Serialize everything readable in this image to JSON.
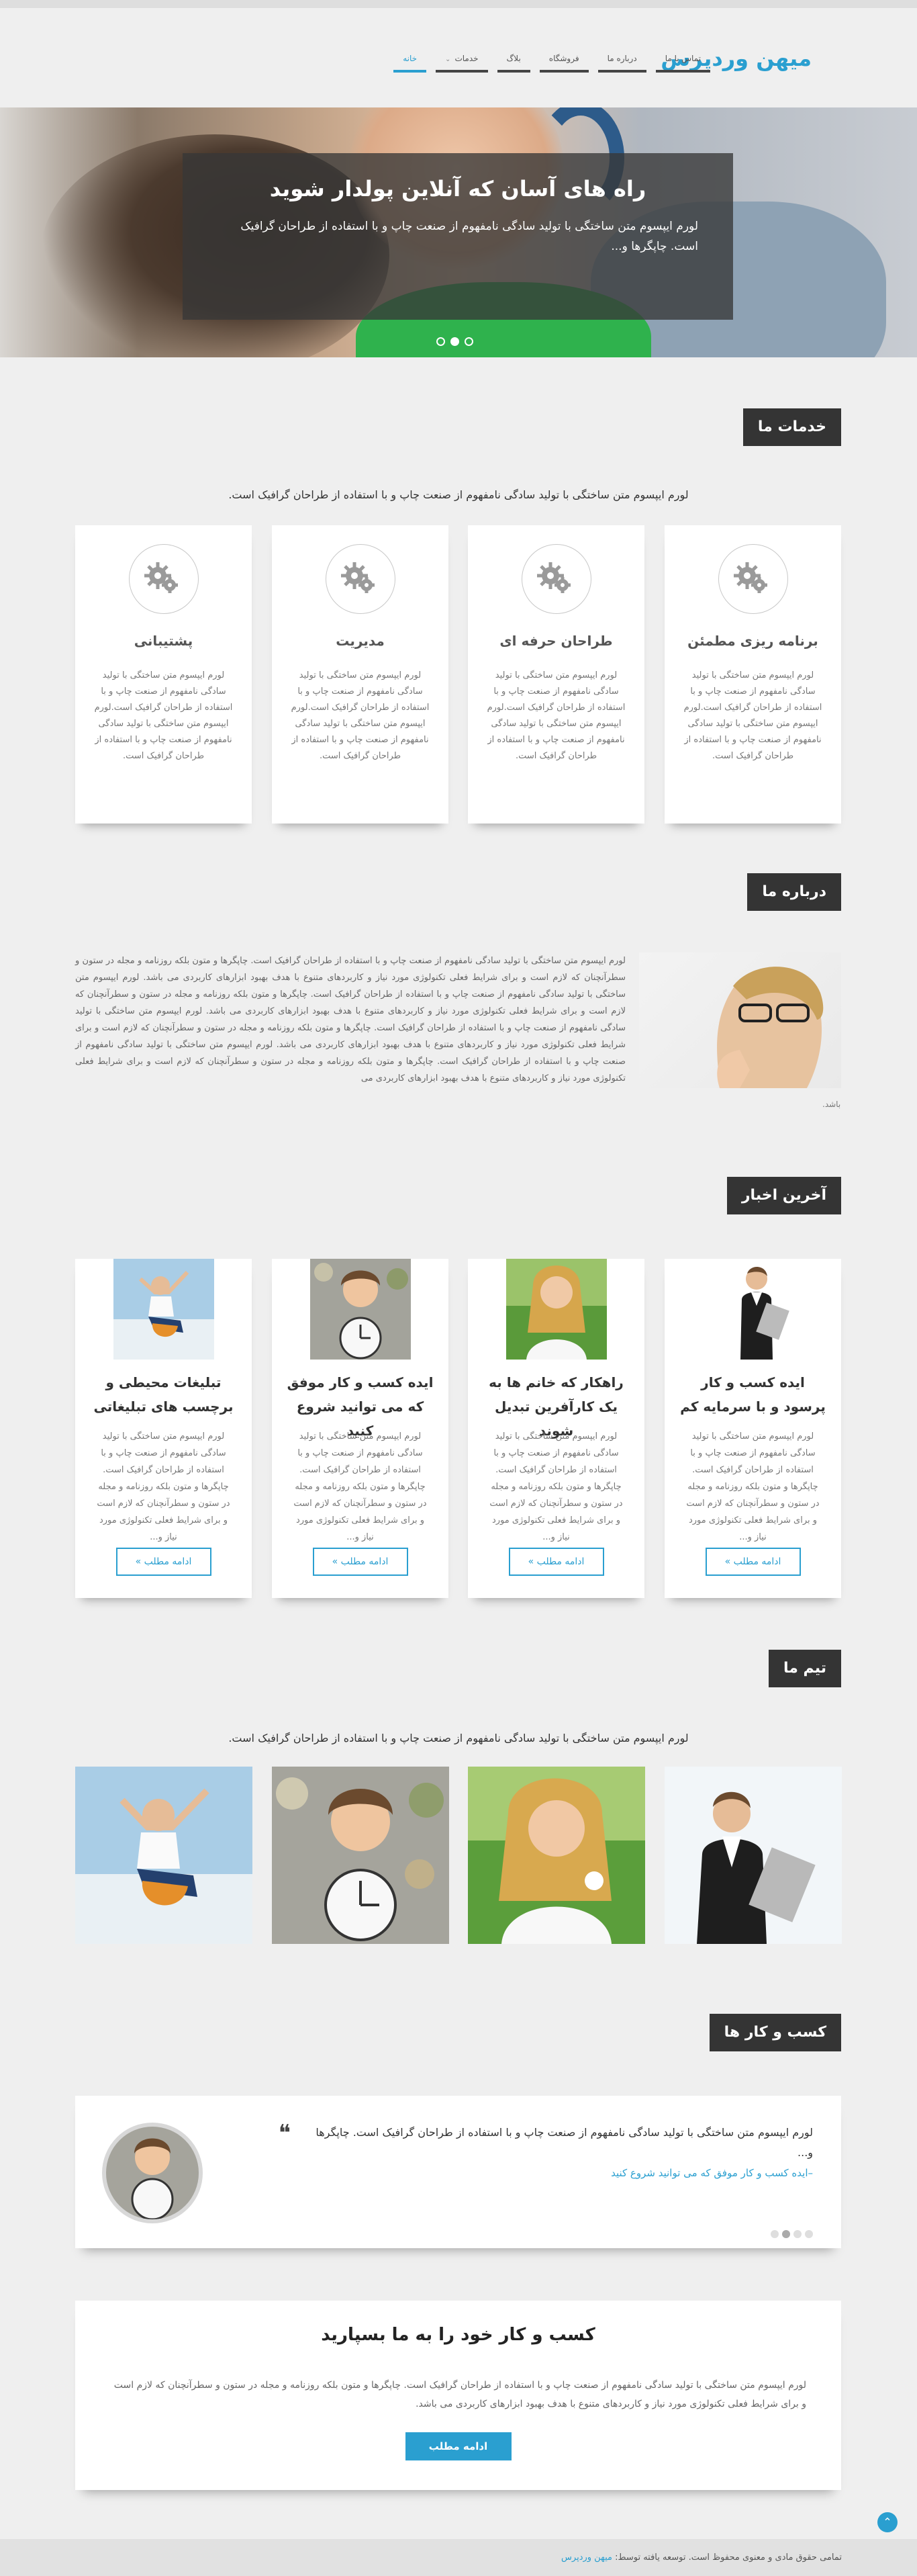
{
  "header": {
    "logo": "میهن وردپرس",
    "nav": [
      {
        "label": "خانه",
        "active": true
      },
      {
        "label": "خدمات",
        "has_dropdown": true
      },
      {
        "label": "بلاگ"
      },
      {
        "label": "فروشگاه"
      },
      {
        "label": "درباره ما"
      },
      {
        "label": "تماس با ما"
      }
    ]
  },
  "hero": {
    "title": "راه های آسان که آنلاین پولدار شوید",
    "text": "لورم ایپسوم متن ساختگی با تولید سادگی نامفهوم از صنعت چاپ و با استفاده از طراحان گرافیک است. چاپگرها و...",
    "slides": 3,
    "active_slide": 2
  },
  "services": {
    "title": "خدمات ما",
    "intro": "لورم ایپسوم متن ساختگی با تولید سادگی نامفهوم از صنعت چاپ و با استفاده از طراحان گرافیک است.",
    "icon": "gears-icon",
    "items": [
      {
        "title": "برنامه ریزی مطمئن",
        "text": "لورم ایپسوم متن ساختگی با تولید سادگی نامفهوم از صنعت چاپ و با استفاده از طراحان گرافیک است.لورم ایپسوم متن ساختگی با تولید سادگی نامفهوم از صنعت چاپ و با استفاده از طراحان گرافیک است."
      },
      {
        "title": "طراحان حرفه ای",
        "text": "لورم ایپسوم متن ساختگی با تولید سادگی نامفهوم از صنعت چاپ و با استفاده از طراحان گرافیک است.لورم ایپسوم متن ساختگی با تولید سادگی نامفهوم از صنعت چاپ و با استفاده از طراحان گرافیک است."
      },
      {
        "title": "مدیریت",
        "text": "لورم ایپسوم متن ساختگی با تولید سادگی نامفهوم از صنعت چاپ و با استفاده از طراحان گرافیک است.لورم ایپسوم متن ساختگی با تولید سادگی نامفهوم از صنعت چاپ و با استفاده از طراحان گرافیک است."
      },
      {
        "title": "پشتیبانی",
        "text": "لورم ایپسوم متن ساختگی با تولید سادگی نامفهوم از صنعت چاپ و با استفاده از طراحان گرافیک است.لورم ایپسوم متن ساختگی با تولید سادگی نامفهوم از صنعت چاپ و با استفاده از طراحان گرافیک است."
      }
    ]
  },
  "about": {
    "title": "درباره ما",
    "text": "لورم ایپسوم متن ساختگی با تولید سادگی نامفهوم از صنعت چاپ و با استفاده از طراحان گرافیک است. چاپگرها و متون بلکه روزنامه و مجله در ستون و سطرآنچنان که لازم است و برای شرایط فعلی تکنولوژی مورد نیاز و کاربردهای متنوع با هدف بهبود ابزارهای کاربردی می باشد. لورم ایپسوم متن ساختگی با تولید سادگی نامفهوم از صنعت چاپ و با استفاده از طراحان گرافیک است. چاپگرها و متون بلکه روزنامه و مجله در ستون و سطرآنچنان که لازم است و برای شرایط فعلی تکنولوژی مورد نیاز و کاربردهای متنوع با هدف بهبود ابزارهای کاربردی می باشد. لورم ایپسوم متن ساختگی با تولید سادگی نامفهوم از صنعت چاپ و با استفاده از طراحان گرافیک است. چاپگرها و متون بلکه روزنامه و مجله در ستون و سطرآنچنان که لازم است و برای شرایط فعلی تکنولوژی مورد نیاز و کاربردهای متنوع با هدف بهبود ابزارهای کاربردی می باشد. لورم ایپسوم متن ساختگی با تولید سادگی نامفهوم از صنعت چاپ و با استفاده از طراحان گرافیک است. چاپگرها و متون بلکه روزنامه و مجله در ستون و سطرآنچنان که لازم است و برای شرایط فعلی تکنولوژی مورد نیاز و کاربردهای متنوع با هدف بهبود ابزارهای کاربردی می",
    "tail": "باشد."
  },
  "news": {
    "title": "آخرین اخبار",
    "read_more": "ادامه مطلب",
    "items": [
      {
        "title": "ایده کسب و کار پرسود و با سرمایه کم",
        "text": "لورم ایپسوم متن ساختگی با تولید سادگی نامفهوم از صنعت چاپ و با استفاده از طراحان گرافیک است. چاپگرها و متون بلکه روزنامه و مجله در ستون و سطرآنچنان که لازم است و برای شرایط فعلی تکنولوژی مورد نیاز و..."
      },
      {
        "title": "راهکار که خانم ها به یک کارآفرین تبدیل شوند",
        "text": "لورم ایپسوم متن ساختگی با تولید سادگی نامفهوم از صنعت چاپ و با استفاده از طراحان گرافیک است. چاپگرها و متون بلکه روزنامه و مجله در ستون و سطرآنچنان که لازم است و برای شرایط فعلی تکنولوژی مورد نیاز و..."
      },
      {
        "title": "ایده کسب و کار موفق که می توانید شروع کنید",
        "text": "لورم ایپسوم متن ساختگی با تولید سادگی نامفهوم از صنعت چاپ و با استفاده از طراحان گرافیک است. چاپگرها و متون بلکه روزنامه و مجله در ستون و سطرآنچنان که لازم است و برای شرایط فعلی تکنولوژی مورد نیاز و..."
      },
      {
        "title": "تبلیغات محیطی و برچسب های تبلیغاتی",
        "text": "لورم ایپسوم متن ساختگی با تولید سادگی نامفهوم از صنعت چاپ و با استفاده از طراحان گرافیک است. چاپگرها و متون بلکه روزنامه و مجله در ستون و سطرآنچنان که لازم است و برای شرایط فعلی تکنولوژی مورد نیاز و..."
      }
    ]
  },
  "team": {
    "title": "تیم ما",
    "intro": "لورم ایپسوم متن ساختگی با تولید سادگی نامفهوم از صنعت چاپ و با استفاده از طراحان گرافیک است."
  },
  "business": {
    "title": "کسب و کار ها",
    "quote": "لورم ایپسوم متن ساختگی با تولید سادگی نامفهوم از صنعت چاپ و با استفاده از طراحان گرافیک است. چاپگرها و...",
    "link": "–ایده کسب و کار موفق که می توانید شروع کنید",
    "dots": 4,
    "active_dot": 2
  },
  "cta": {
    "title": "کسب و کار خود را به ما بسپارید",
    "text": "لورم ایپسوم متن ساختگی با تولید سادگی نامفهوم از صنعت چاپ و با استفاده از طراحان گرافیک است. چاپگرها و متون بلکه روزنامه و مجله در ستون و سطرآنچنان که لازم است و برای شرایط فعلی تکنولوژی مورد نیاز و کاربردهای متنوع با هدف بهبود ابزارهای کاربردی می باشد.",
    "button": "ادامه مطلب"
  },
  "footer": {
    "text": "تمامی حقوق مادی و معنوی محفوظ است. توسعه یافته توسط:",
    "link": "میهن وردپرس"
  },
  "colors": {
    "accent": "#2a9fd0",
    "dark": "#343434",
    "background": "#efefef"
  }
}
